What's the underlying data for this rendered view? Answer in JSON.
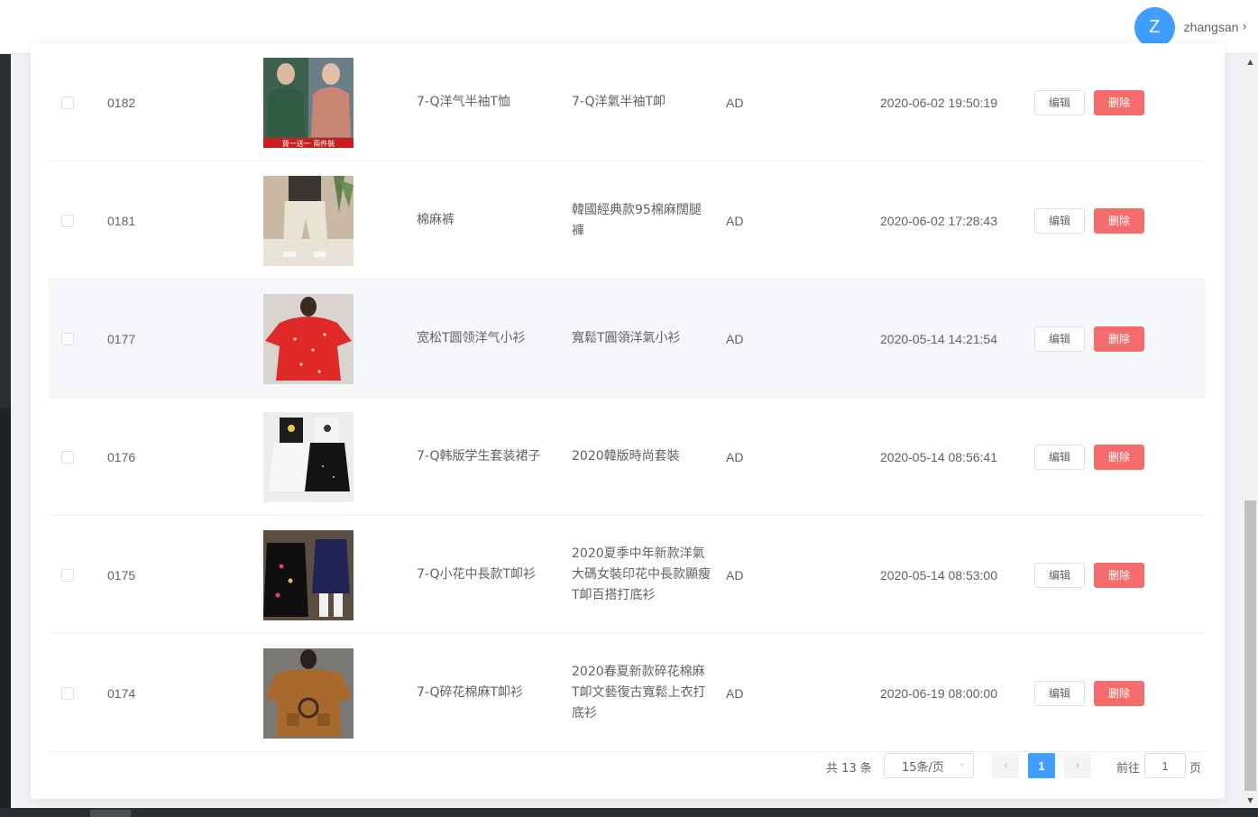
{
  "header": {
    "avatar_letter": "Z",
    "username": "zhangsan",
    "chevron": "›"
  },
  "colors": {
    "primary": "#409eff",
    "danger": "#f56c6c",
    "border": "#ebeef5"
  },
  "rows": [
    {
      "id": "0182",
      "name": "7-Q洋气半袖T恤",
      "name_tw": "7-Q洋氣半袖T卹",
      "user": "AD",
      "time": "2020-06-02 19:50:19",
      "edit": "编辑",
      "delete": "删除",
      "image_caption": "買一送一 兩件裝"
    },
    {
      "id": "0181",
      "name": "棉麻裤",
      "name_tw": "韓國經典款95棉麻闊腿褲",
      "user": "AD",
      "time": "2020-06-02 17:28:43",
      "edit": "编辑",
      "delete": "删除"
    },
    {
      "id": "0177",
      "name": "宽松T圆领洋气小衫",
      "name_tw": "寬鬆T圓領洋氣小衫",
      "user": "AD",
      "time": "2020-05-14 14:21:54",
      "edit": "编辑",
      "delete": "删除"
    },
    {
      "id": "0176",
      "name": "7-Q韩版学生套装裙子",
      "name_tw": "2020韓版時尚套裝",
      "user": "AD",
      "time": "2020-05-14 08:56:41",
      "edit": "编辑",
      "delete": "删除"
    },
    {
      "id": "0175",
      "name": "7-Q小花中長款T卹衫",
      "name_tw": "2020夏季中年新款洋氣大碼女裝印花中長款顯瘦T卹百搭打底衫",
      "user": "AD",
      "time": "2020-05-14 08:53:00",
      "edit": "编辑",
      "delete": "删除"
    },
    {
      "id": "0174",
      "name": "7-Q碎花棉麻T卹衫",
      "name_tw": "2020春夏新款碎花棉麻T卹文藝復古寬鬆上衣打底衫",
      "user": "AD",
      "time": "2020-06-19 08:00:00",
      "edit": "编辑",
      "delete": "删除"
    }
  ],
  "pagination": {
    "total": "共 13 条",
    "page_size": "15条/页",
    "current_page": "1",
    "goto_label": "前往",
    "goto_value": "1",
    "goto_suffix": "页",
    "prev": "‹",
    "next": "›"
  },
  "scrollbar": {
    "up": "▲",
    "down": "▼"
  }
}
